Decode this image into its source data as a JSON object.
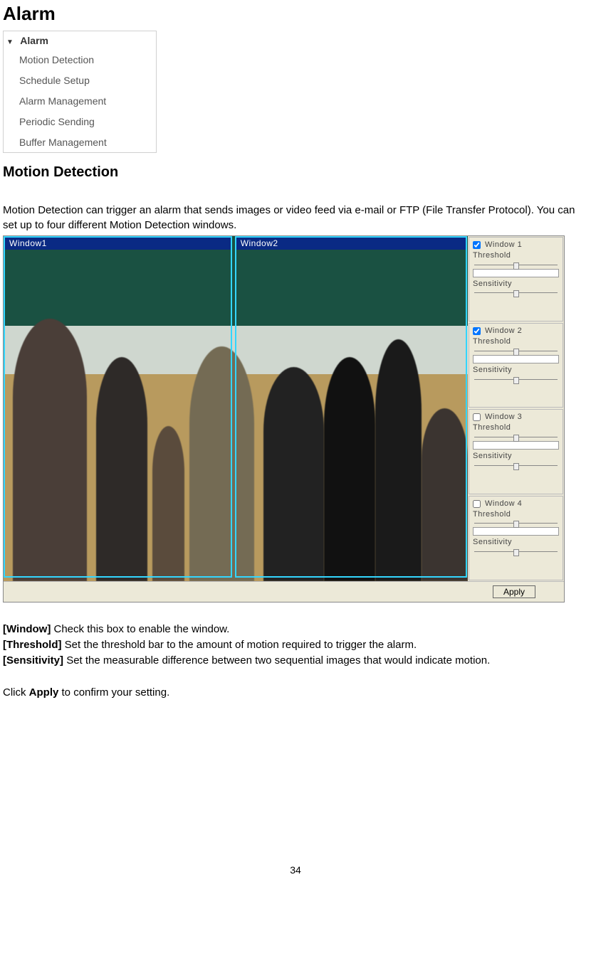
{
  "headings": {
    "h1": "Alarm",
    "h2": "Motion Detection"
  },
  "menu": {
    "title": "Alarm",
    "items": [
      "Motion Detection",
      "Schedule Setup",
      "Alarm Management",
      "Periodic Sending",
      "Buffer Management"
    ]
  },
  "intro": "Motion Detection can trigger an alarm that sends images or video feed via e-mail or FTP (File Transfer Protocol). You can set up to four different Motion Detection windows.",
  "motion_windows": {
    "labels": [
      "Window1",
      "Window2"
    ]
  },
  "controls": {
    "threshold_label": "Threshold",
    "sensitivity_label": "Sensitivity",
    "groups": [
      {
        "name": "Window 1",
        "checked": true
      },
      {
        "name": "Window 2",
        "checked": true
      },
      {
        "name": "Window 3",
        "checked": false
      },
      {
        "name": "Window 4",
        "checked": false
      }
    ],
    "apply_label": "Apply"
  },
  "definitions": {
    "window": {
      "term": "[Window]",
      "desc": " Check this box to enable the window."
    },
    "threshold": {
      "term": "[Threshold]",
      "desc": " Set the threshold bar to the amount of motion required to trigger the alarm."
    },
    "sensitivity": {
      "term": "[Sensitivity]",
      "desc": " Set the measurable difference between two sequential images that would indicate motion."
    }
  },
  "apply_instruction": {
    "pre": "Click ",
    "bold": "Apply",
    "post": " to confirm your setting."
  },
  "page_number": "34"
}
